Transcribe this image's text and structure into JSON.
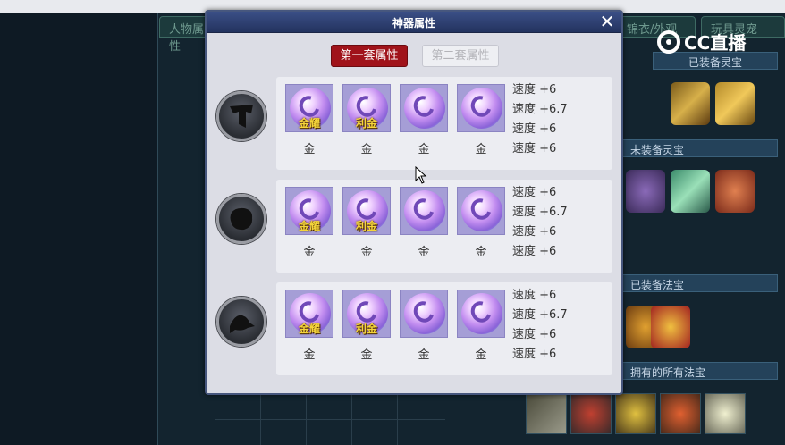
{
  "background": {
    "tabs": [
      "人物属性",
      "锦衣/外观",
      "玩具灵宠"
    ],
    "headers": {
      "equipped_lingbao": "已装备灵宝",
      "unequipped_lingbao": "未装备灵宝",
      "equipped_fabao": "已装备法宝",
      "all_fabao": "拥有的所有法宝"
    },
    "logo_text": "CC直播"
  },
  "popup": {
    "title": "神器属性",
    "tabs": {
      "set1": "第一套属性",
      "set2": "第二套属性"
    },
    "rows": [
      {
        "icon": "flag-silhouette-icon",
        "gems": [
          {
            "overlay": "金耀",
            "name": "金"
          },
          {
            "overlay": "利金",
            "name": "金"
          },
          {
            "overlay": "",
            "name": "金"
          },
          {
            "overlay": "",
            "name": "金"
          }
        ],
        "stats": [
          "速度 +6",
          "速度 +6.7",
          "速度 +6",
          "速度 +6"
        ]
      },
      {
        "icon": "stone-silhouette-icon",
        "gems": [
          {
            "overlay": "金耀",
            "name": "金"
          },
          {
            "overlay": "利金",
            "name": "金"
          },
          {
            "overlay": "",
            "name": "金"
          },
          {
            "overlay": "",
            "name": "金"
          }
        ],
        "stats": [
          "速度 +6",
          "速度 +6.7",
          "速度 +6",
          "速度 +6"
        ]
      },
      {
        "icon": "bird-silhouette-icon",
        "gems": [
          {
            "overlay": "金耀",
            "name": "金"
          },
          {
            "overlay": "利金",
            "name": "金"
          },
          {
            "overlay": "",
            "name": "金"
          },
          {
            "overlay": "",
            "name": "金"
          }
        ],
        "stats": [
          "速度 +6",
          "速度 +6.7",
          "速度 +6",
          "速度 +6"
        ]
      }
    ]
  }
}
